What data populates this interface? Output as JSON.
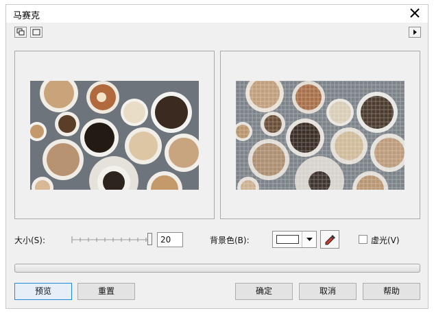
{
  "window": {
    "title": "马赛克"
  },
  "toolbar": {
    "icons": [
      "dual-preview-icon",
      "single-preview-icon",
      "expand-arrow-icon"
    ]
  },
  "controls": {
    "size_label": "大小(S):",
    "size_value": "20",
    "background_label": "背景色(B):",
    "background_color": "#ffffff",
    "vignette_label": "虚光(V)",
    "vignette_checked": false
  },
  "buttons": {
    "preview": "预览",
    "reset": "重置",
    "ok": "确定",
    "cancel": "取消",
    "help": "帮助"
  },
  "colors": {
    "accent": "#1e8ad6",
    "window_bg": "#f0f0f0"
  }
}
